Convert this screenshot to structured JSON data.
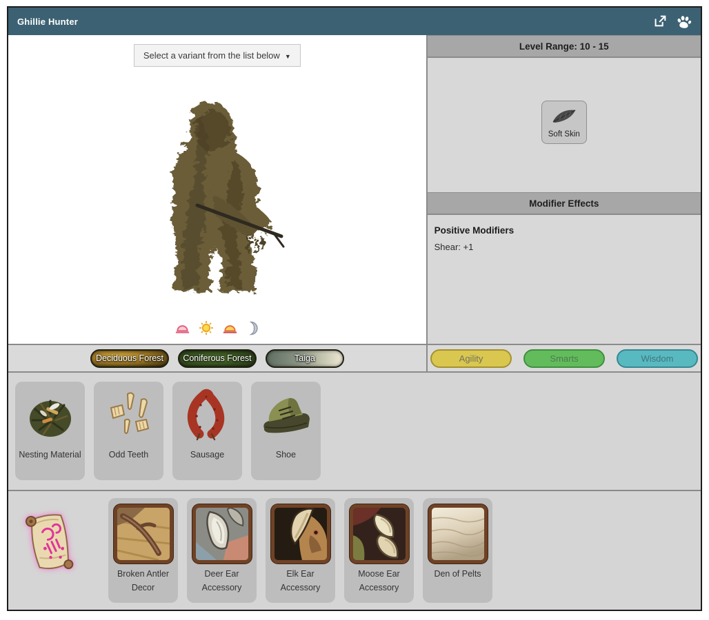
{
  "topbar": {
    "title": "Ghillie Hunter",
    "icons": [
      "external-link-icon",
      "paw-icon"
    ]
  },
  "left_panel": {
    "variant_selector_label": "Select a variant from the list below",
    "time_of_day_icons": [
      "sunrise-icon",
      "sun-icon",
      "sunset-icon",
      "moon-icon"
    ]
  },
  "biomes": [
    {
      "label": "Deciduous Forest"
    },
    {
      "label": "Coniferous Forest"
    },
    {
      "label": "Taiga"
    }
  ],
  "right_panel": {
    "level_range_header": "Level Range: 10 - 15",
    "abilities": [
      {
        "label": "Soft Skin",
        "icon": "feather-icon"
      }
    ],
    "modifier_header": "Modifier Effects",
    "positive_modifiers_title": "Positive Modifiers",
    "modifiers": [
      {
        "text": "Shear: +1"
      }
    ],
    "stats": [
      {
        "label": "Agility",
        "color": "#d9c750",
        "border": "#a5912f"
      },
      {
        "label": "Smarts",
        "color": "#63bc5c",
        "border": "#3f8f3d"
      },
      {
        "label": "Wisdom",
        "color": "#59b9c1",
        "border": "#368791"
      }
    ]
  },
  "loot_items": [
    {
      "name": "Nesting Material",
      "icon": "nesting-material-icon"
    },
    {
      "name": "Odd Teeth",
      "icon": "odd-teeth-icon"
    },
    {
      "name": "Sausage",
      "icon": "sausage-icon"
    },
    {
      "name": "Shoe",
      "icon": "shoe-icon"
    }
  ],
  "recipe_scroll_icon": "recipe-scroll-icon",
  "craft_items": [
    {
      "name": "Broken Antler Decor",
      "icon": "broken-antler-icon"
    },
    {
      "name": "Deer Ear Accessory",
      "icon": "deer-ear-icon"
    },
    {
      "name": "Elk Ear Accessory",
      "icon": "elk-ear-icon"
    },
    {
      "name": "Moose Ear Accessory",
      "icon": "moose-ear-icon"
    },
    {
      "name": "Den of Pelts",
      "icon": "den-of-pelts-icon"
    }
  ]
}
